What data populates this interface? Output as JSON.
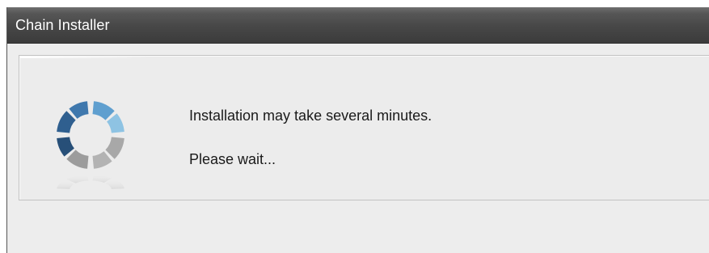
{
  "window": {
    "title": "Chain Installer"
  },
  "content": {
    "icon": "progress-spinner-icon",
    "message_line1": "Installation may take several minutes.",
    "message_line2": "Please wait..."
  },
  "colors": {
    "titlebar": "#474747",
    "window_bg": "#ededed",
    "spinner_blue_dark": "#2f5e8e",
    "spinner_blue_light": "#6fb0d8",
    "spinner_gray": "#9a9a9a"
  }
}
